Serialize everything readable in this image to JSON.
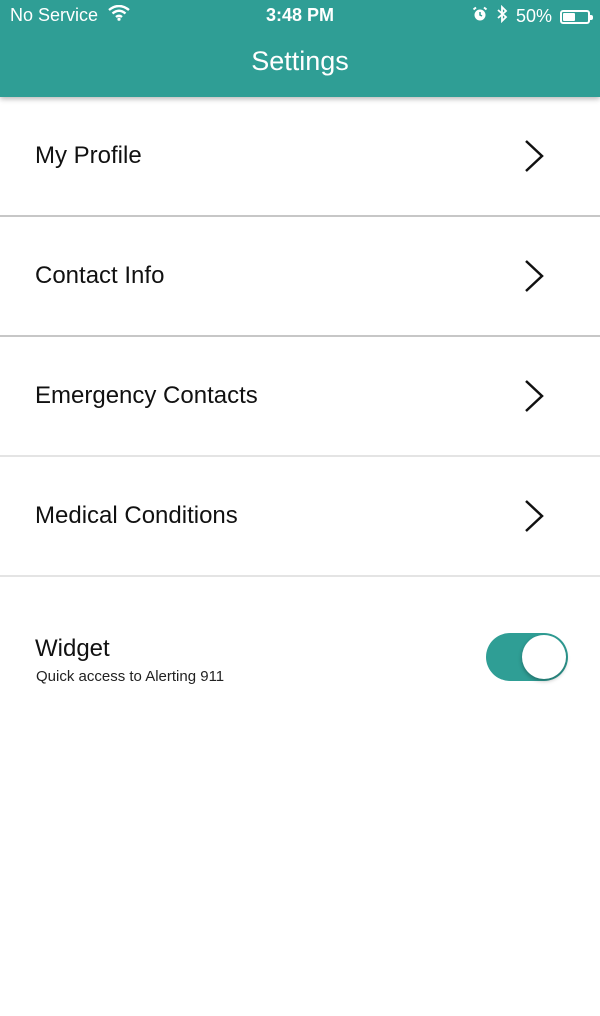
{
  "status_bar": {
    "carrier": "No Service",
    "time": "3:48 PM",
    "battery_text": "50%",
    "battery_level": 0.5
  },
  "header": {
    "title": "Settings",
    "color": "#2f9e95"
  },
  "menu": {
    "items": [
      {
        "label": "My Profile",
        "icon": "chevron-right-icon"
      },
      {
        "label": "Contact Info",
        "icon": "chevron-right-icon"
      },
      {
        "label": "Emergency Contacts",
        "icon": "chevron-right-icon"
      },
      {
        "label": "Medical Conditions",
        "icon": "chevron-right-icon"
      }
    ]
  },
  "widget": {
    "title": "Widget",
    "subtitle": "Quick access to Alerting 911",
    "enabled": true
  }
}
